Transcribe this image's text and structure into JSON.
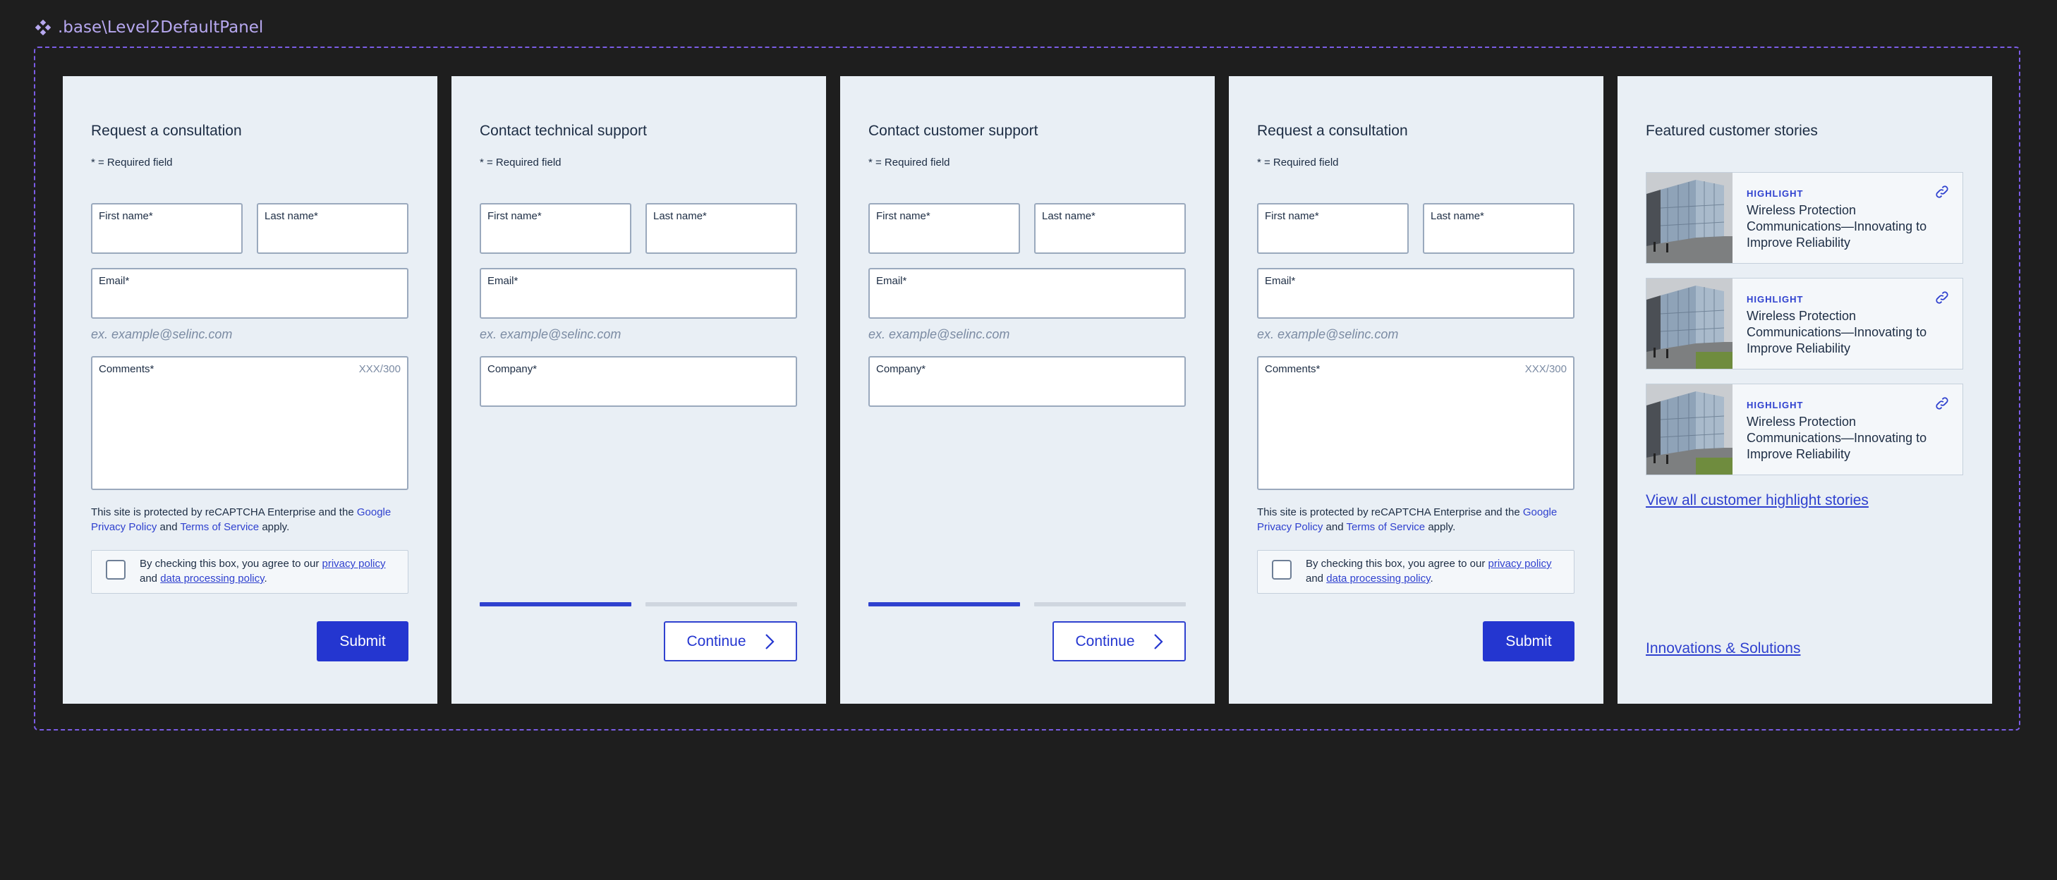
{
  "header": {
    "component_path": ".base\\Level2DefaultPanel",
    "icon": "component-icon"
  },
  "colors": {
    "accent": "#2436d0",
    "panel_bg": "#e9eff5",
    "frame_border": "#7b5ce6",
    "page_bg": "#1e1e1e"
  },
  "panels": [
    {
      "title": "Request a consultation",
      "required_note": "* = Required field",
      "first_name_label": "First name*",
      "last_name_label": "Last name*",
      "email_label": "Email*",
      "email_hint": "ex. example@selinc.com",
      "comments_label": "Comments*",
      "comments_counter": "XXX/300",
      "captcha": {
        "prefix": "This site is protected by reCAPTCHA Enterprise and the ",
        "google_link": "Google Privacy  Policy",
        "and": " and ",
        "terms_link": "Terms of Service",
        "suffix": " apply."
      },
      "consent": {
        "prefix": "By checking this box, you agree to our ",
        "privacy_link": "privacy policy",
        "and": " and ",
        "data_link": "data processing policy",
        "suffix": "."
      },
      "submit_label": "Submit"
    },
    {
      "title": "Contact technical support",
      "required_note": "* = Required field",
      "first_name_label": "First name*",
      "last_name_label": "Last name*",
      "email_label": "Email*",
      "email_hint": "ex. example@selinc.com",
      "company_label": "Company*",
      "step_progress": {
        "current": 1,
        "total": 2
      },
      "continue_label": "Continue"
    },
    {
      "title": "Contact customer support",
      "required_note": "* = Required field",
      "first_name_label": "First name*",
      "last_name_label": "Last name*",
      "email_label": "Email*",
      "email_hint": "ex. example@selinc.com",
      "company_label": "Company*",
      "step_progress": {
        "current": 1,
        "total": 2
      },
      "continue_label": "Continue"
    },
    {
      "title": "Request a consultation",
      "required_note": "* = Required field",
      "first_name_label": "First name*",
      "last_name_label": "Last name*",
      "email_label": "Email*",
      "email_hint": "ex. example@selinc.com",
      "comments_label": "Comments*",
      "comments_counter": "XXX/300",
      "captcha": {
        "prefix": "This site is protected by reCAPTCHA Enterprise and the ",
        "google_link": "Google Privacy  Policy",
        "and": " and ",
        "terms_link": "Terms of Service",
        "suffix": " apply."
      },
      "consent": {
        "prefix": "By checking this box, you agree to our ",
        "privacy_link": "privacy policy",
        "and": " and ",
        "data_link": "data processing policy",
        "suffix": "."
      },
      "submit_label": "Submit"
    },
    {
      "title": "Featured customer stories",
      "stories": [
        {
          "tag": "HIGHLIGHT",
          "title": "Wireless Protection Communications—Innovating to Improve Reliability",
          "icon": "link-icon"
        },
        {
          "tag": "HIGHLIGHT",
          "title": "Wireless Protection Communications—Innovating to Improve Reliability",
          "icon": "link-icon"
        },
        {
          "tag": "HIGHLIGHT",
          "title": "Wireless Protection Communications—Innovating to Improve Reliability",
          "icon": "link-icon"
        }
      ],
      "view_all_link": "View all customer highlight stories",
      "footer_link": "Innovations & Solutions"
    }
  ]
}
